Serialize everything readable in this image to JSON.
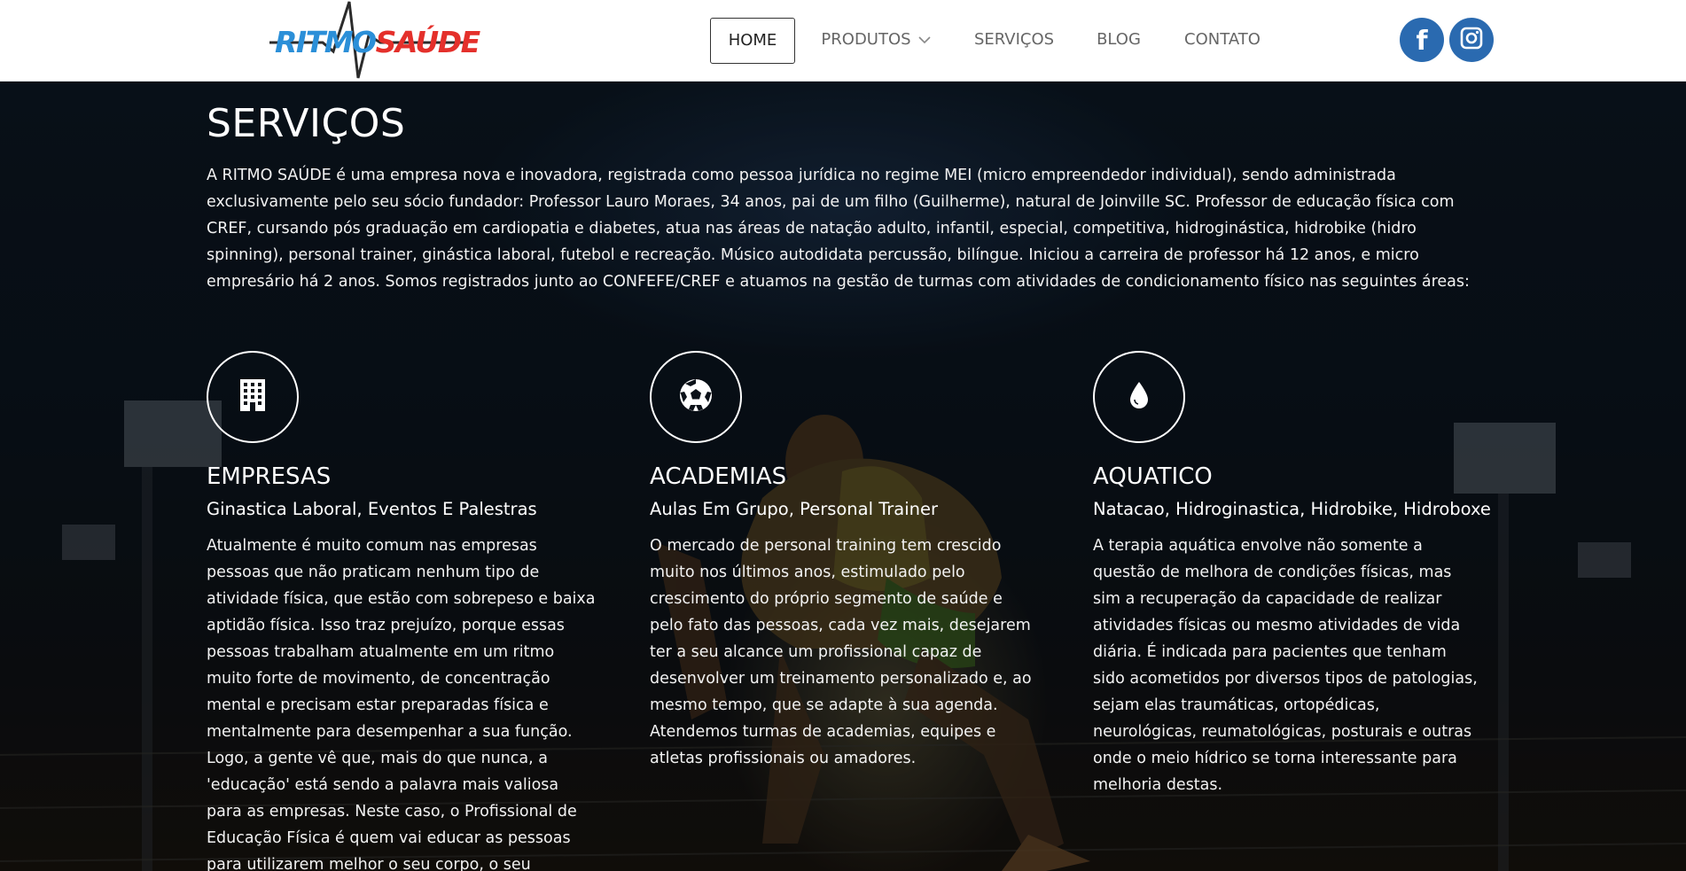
{
  "header": {
    "logo": {
      "part1": "RITMO",
      "part2": "SAÚDE"
    },
    "nav": [
      {
        "label": "HOME",
        "active": true
      },
      {
        "label": "PRODUTOS",
        "has_dropdown": true
      },
      {
        "label": "SERVIÇOS"
      },
      {
        "label": "BLOG"
      },
      {
        "label": "CONTATO"
      }
    ],
    "social": [
      {
        "icon": "facebook-icon",
        "glyph": "f"
      },
      {
        "icon": "instagram-icon"
      }
    ],
    "colors": {
      "social_bg": "#2a6ab0",
      "logo_blue": "#2b8fd8",
      "logo_red": "#e4302b"
    }
  },
  "main": {
    "title": "SERVIÇOS",
    "intro": "A RITMO SAÚDE é uma empresa nova e inovadora, registrada como pessoa jurídica no regime MEI (micro empreendedor individual), sendo administrada exclusivamente pelo seu sócio fundador: Professor Lauro Moraes, 34 anos, pai de um filho (Guilherme), natural de Joinville SC. Professor de educação física com CREF, cursando pós graduação em cardiopatia e diabetes, atua nas áreas de natação adulto, infantil, especial, competitiva, hidroginástica, hidrobike (hidro spinning), personal trainer, ginástica laboral, futebol e recreação. Músico autodidata percussão, bilíngue. Iniciou a carreira de professor há 12 anos, e micro empresário há 2 anos. Somos registrados junto ao CONFEFE/CREF e atuamos na gestão de turmas com atividades de condicionamento físico nas seguintes áreas:",
    "services": [
      {
        "icon": "building-icon",
        "title": "EMPRESAS",
        "subtitle": "Ginastica Laboral, Eventos E Palestras",
        "text": "Atualmente é muito comum nas empresas pessoas que não praticam nenhum tipo de atividade física, que estão com sobrepeso e baixa aptidão física. Isso traz prejuízo, porque essas pessoas trabalham atualmente em um ritmo muito forte de movimento, de concentração mental e precisam estar preparadas física e mentalmente para desempenhar a sua função. Logo, a gente vê que, mais do que nunca, a 'educação' está sendo a palavra mais valiosa para as empresas. Neste caso, o Profissional de Educação Física é quem vai educar as pessoas para utilizarem melhor o seu corpo, o seu movimento de forma adequada nas"
      },
      {
        "icon": "soccer-ball-icon",
        "title": "ACADEMIAS",
        "subtitle": "Aulas Em Grupo, Personal Trainer",
        "text": "O mercado de personal training tem crescido muito nos últimos anos, estimulado pelo crescimento do próprio segmento de saúde e pelo fato das pessoas, cada vez mais, desejarem ter a seu alcance um profissional capaz de desenvolver um treinamento personalizado e, ao mesmo tempo, que se adapte à sua agenda. Atendemos turmas de academias, equipes e atletas profissionais ou amadores."
      },
      {
        "icon": "water-drop-icon",
        "title": "AQUATICO",
        "subtitle": "Natacao, Hidroginastica, Hidrobike, Hidroboxe",
        "text": "A terapia aquática envolve não somente a questão de melhora de condições físicas, mas sim a recuperação da capacidade de realizar atividades físicas ou mesmo atividades de vida diária. É indicada para pacientes que tenham sido acometidos por diversos tipos de patologias, sejam elas traumáticas, ortopédicas, neurológicas, reumatológicas, posturais e outras onde o meio hídrico se torna interessante para melhoria destas."
      }
    ]
  }
}
